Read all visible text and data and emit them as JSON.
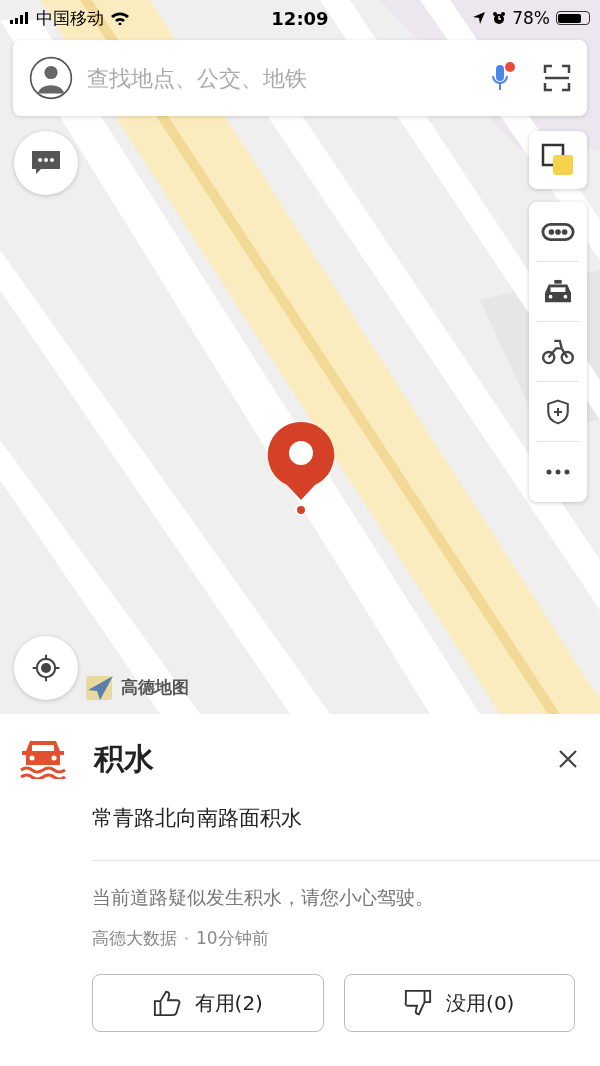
{
  "status_bar": {
    "carrier": "中国移动",
    "time": "12:09",
    "battery": "78%"
  },
  "search": {
    "placeholder": "查找地点、公交、地铁",
    "voice_badge": true
  },
  "map": {
    "logo": "高德地图"
  },
  "right_tools": [
    {
      "kind": "traffic"
    },
    {
      "kind": "taxi"
    },
    {
      "kind": "bike"
    },
    {
      "kind": "shield"
    },
    {
      "kind": "more"
    }
  ],
  "event": {
    "title": "积水",
    "location": "常青路北向南路面积水",
    "description": "当前道路疑似发生积水，请您小心驾驶。",
    "source": "高德大数据",
    "time": "10分钟前",
    "buttons": [
      {
        "kind": "up",
        "label": "有用(2)"
      },
      {
        "kind": "down",
        "label": "没用(0)"
      }
    ]
  }
}
